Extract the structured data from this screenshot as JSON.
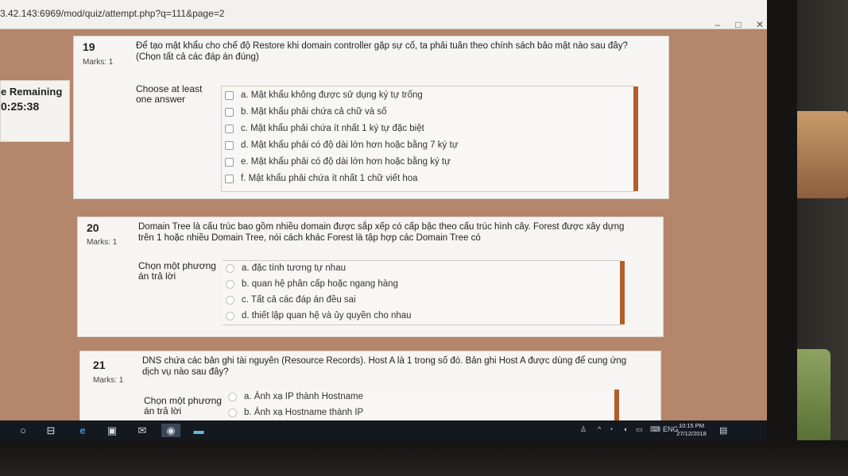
{
  "browser": {
    "url": "3.42.143:6969/mod/quiz/attempt.php?q=111&page=2",
    "controls": [
      "–",
      "□",
      "✕"
    ]
  },
  "timer": {
    "label": "e Remaining",
    "value": "0:25:38"
  },
  "questions": [
    {
      "number": "19",
      "marks": "Marks: 1",
      "text": "Để tạo mật khẩu cho chế độ Restore khi domain controller gặp sự cố, ta phải tuân theo chính sách bảo mật nào sau đây?",
      "text2": "(Chọn tất cả các đáp án đúng)",
      "prompt": "Choose at least one answer",
      "input": "checkbox",
      "options": [
        "a. Mật khẩu không được sử dụng ký tự trống",
        "b. Mật khẩu phải chứa cả chữ và số",
        "c. Mật khẩu phải chứa ít nhất 1 ký tự đặc biệt",
        "d. Mật khẩu phải có độ dài lớn hơn hoặc bằng 7 ký tự",
        "e. Mật khẩu phải có độ dài lớn hơn hoặc bằng ký tự",
        "f. Mật khẩu phải chứa ít nhất 1 chữ viết hoa"
      ]
    },
    {
      "number": "20",
      "marks": "Marks: 1",
      "text": "Domain Tree là cấu trúc bao gồm nhiều domain được sắp xếp có cấp bậc theo cấu trúc hình cây. Forest được xây dựng",
      "text2": "trên 1 hoặc nhiều Domain Tree, nói cách khác Forest là tập hợp các Domain Tree có",
      "prompt": "Chọn một phương án trả lời",
      "input": "radio",
      "options": [
        "a. đặc tính tương tự nhau",
        "b. quan hệ phân cấp hoặc ngang hàng",
        "c. Tất cả các đáp án đều sai",
        "d. thiết lập quan hệ và ủy quyền cho nhau"
      ]
    },
    {
      "number": "21",
      "marks": "Marks: 1",
      "text": "DNS chứa các bản ghi tài nguyên (Resource Records). Host A là 1 trong số đó. Bản ghi Host A được dùng để cung ứng",
      "text2": "dịch vụ nào sau đây?",
      "prompt": "Chọn một phương án trả lời",
      "input": "radio",
      "options": [
        "a. Ánh xạ IP thành Hostname",
        "b. Ánh xạ Hostname thành IP"
      ]
    }
  ],
  "taskbar": {
    "icons": [
      "start-circle-icon",
      "task-view-icon",
      "edge-icon",
      "store-icon",
      "mail-icon",
      "chrome-icon",
      "app-icon"
    ],
    "language": "ENG",
    "time": "10:15 PM",
    "date": "27/12/2018"
  }
}
